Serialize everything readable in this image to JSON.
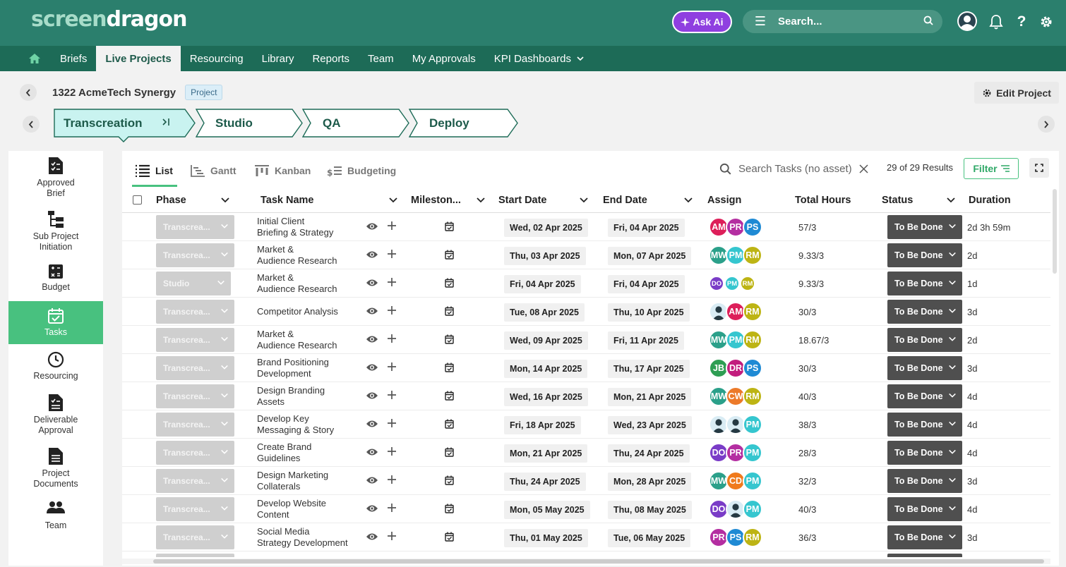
{
  "app": {
    "logo_part1": "screen",
    "logo_part2": "dragon"
  },
  "topbar": {
    "ask_ai_label": "Ask Ai",
    "search_placeholder": "Search...",
    "icons": [
      "user-avatar-icon",
      "bell-icon",
      "help-icon",
      "gear-icon"
    ]
  },
  "nav": {
    "items": [
      {
        "label": ""
      },
      {
        "label": "Briefs"
      },
      {
        "label": "Live Projects",
        "active": true
      },
      {
        "label": "Resourcing"
      },
      {
        "label": "Library"
      },
      {
        "label": "Reports"
      },
      {
        "label": "Team"
      },
      {
        "label": "My Approvals"
      },
      {
        "label": "KPI Dashboards"
      }
    ]
  },
  "project": {
    "title": "1322 AcmeTech Synergy",
    "badge": "Project",
    "edit_label": "Edit Project"
  },
  "phases": [
    {
      "label": "Transcreation",
      "active": true
    },
    {
      "label": "Studio"
    },
    {
      "label": "QA"
    },
    {
      "label": "Deploy"
    }
  ],
  "sidebar": {
    "items": [
      {
        "label1": "Approved",
        "label2": "Brief",
        "icon": "checklist-document-icon"
      },
      {
        "label1": "Sub Project",
        "label2": "Initiation",
        "icon": "hierarchy-icon"
      },
      {
        "label1": "Budget",
        "label2": "",
        "icon": "calculator-icon"
      },
      {
        "label1": "Tasks",
        "label2": "",
        "icon": "calendar-check-icon",
        "active": true
      },
      {
        "label1": "Resourcing",
        "label2": "",
        "icon": "clock-icon"
      },
      {
        "label1": "Deliverable",
        "label2": "Approval",
        "icon": "document-check-icon"
      },
      {
        "label1": "Project",
        "label2": "Documents",
        "icon": "document-icon"
      },
      {
        "label1": "Team",
        "label2": "",
        "icon": "people-icon"
      }
    ]
  },
  "views": [
    {
      "label": "List",
      "active": true
    },
    {
      "label": "Gantt"
    },
    {
      "label": "Kanban"
    },
    {
      "label": "Budgeting"
    }
  ],
  "task_search": {
    "placeholder": "Search Tasks (no asset)",
    "results": "29 of 29 Results",
    "filter_label": "Filter"
  },
  "columns": [
    "Phase",
    "Task Name",
    "Mileston...",
    "Start Date",
    "End Date",
    "Assign",
    "Total Hours",
    "Status",
    "Duration"
  ],
  "colors": {
    "brand": "#2b7f6d",
    "nav": "#1d6b57",
    "accent": "#48c17f",
    "ask_ai": "#8f3fe0",
    "status_bg": "#4f4f4f"
  },
  "avatar_colors": {
    "AM": "#dd1f5a",
    "PR": "#b42ea1",
    "PS": "#1f8ad4",
    "MW": "#2ba08a",
    "PM": "#35c6cf",
    "RM": "#bdb414",
    "DO": "#7a3cc7",
    "JB": "#2e9e53",
    "DR": "#c21d7d",
    "CW": "#ec7a2a",
    "CD": "#f07a1c"
  },
  "tasks": [
    {
      "phase": "Transcrea...",
      "name1": "Initial Client",
      "name2": "Briefing & Strategy",
      "start": "Wed, 02 Apr 2025",
      "end": "Fri, 04 Apr 2025",
      "assign": [
        "AM",
        "PR",
        "PS"
      ],
      "hours": "57/3",
      "status": "To Be Done",
      "duration": "2d 3h 59m"
    },
    {
      "phase": "Transcrea...",
      "name1": "Market &",
      "name2": "Audience Research",
      "start": "Thu, 03 Apr 2025",
      "end": "Mon, 07 Apr 2025",
      "assign": [
        "MW",
        "PM",
        "RM"
      ],
      "hours": "9.33/3",
      "status": "To Be Done",
      "duration": "2d"
    },
    {
      "phase": "Studio",
      "name1": "Market &",
      "name2": "Audience Research",
      "start": "Fri, 04 Apr 2025",
      "end": "Fri, 04 Apr 2025",
      "assign": [
        "DO",
        "PM",
        "RM"
      ],
      "assign_small": true,
      "hours": "9.33/3",
      "status": "To Be Done",
      "duration": "1d"
    },
    {
      "phase": "Transcrea...",
      "name1": "Competitor Analysis",
      "name2": "",
      "start": "Tue, 08 Apr 2025",
      "end": "Thu, 10 Apr 2025",
      "assign": [
        "@",
        "AM",
        "RM"
      ],
      "hours": "30/3",
      "status": "To Be Done",
      "duration": "3d"
    },
    {
      "phase": "Transcrea...",
      "name1": "Market &",
      "name2": "Audience Research",
      "start": "Wed, 09 Apr 2025",
      "end": "Fri, 11 Apr 2025",
      "assign": [
        "MW",
        "PM",
        "RM"
      ],
      "hours": "18.67/3",
      "status": "To Be Done",
      "duration": "2d"
    },
    {
      "phase": "Transcrea...",
      "name1": "Brand Positioning",
      "name2": "Development",
      "start": "Mon, 14 Apr 2025",
      "end": "Thu, 17 Apr 2025",
      "assign": [
        "JB",
        "DR",
        "PS"
      ],
      "hours": "30/3",
      "status": "To Be Done",
      "duration": "3d"
    },
    {
      "phase": "Transcrea...",
      "name1": "Design Branding",
      "name2": "Assets",
      "start": "Wed, 16 Apr 2025",
      "end": "Mon, 21 Apr 2025",
      "assign": [
        "MW",
        "CW",
        "RM"
      ],
      "hours": "40/3",
      "status": "To Be Done",
      "duration": "4d"
    },
    {
      "phase": "Transcrea...",
      "name1": "Develop Key",
      "name2": "Messaging & Story",
      "start": "Fri, 18 Apr 2025",
      "end": "Wed, 23 Apr 2025",
      "assign": [
        "@",
        "@",
        "PM"
      ],
      "hours": "38/3",
      "status": "To Be Done",
      "duration": "4d"
    },
    {
      "phase": "Transcrea...",
      "name1": "Create Brand",
      "name2": "Guidelines",
      "start": "Mon, 21 Apr 2025",
      "end": "Thu, 24 Apr 2025",
      "assign": [
        "DO",
        "PR",
        "PM"
      ],
      "hours": "28/3",
      "status": "To Be Done",
      "duration": "4d"
    },
    {
      "phase": "Transcrea...",
      "name1": "Design Marketing",
      "name2": "Collaterals",
      "start": "Thu, 24 Apr 2025",
      "end": "Mon, 28 Apr 2025",
      "assign": [
        "MW",
        "CD",
        "PM"
      ],
      "hours": "32/3",
      "status": "To Be Done",
      "duration": "3d"
    },
    {
      "phase": "Transcrea...",
      "name1": "Develop Website",
      "name2": "Content",
      "start": "Mon, 05 May 2025",
      "end": "Thu, 08 May 2025",
      "assign": [
        "DO",
        "@",
        "PM"
      ],
      "hours": "40/3",
      "status": "To Be Done",
      "duration": "4d"
    },
    {
      "phase": "Transcrea...",
      "name1": "Social Media",
      "name2": "Strategy Development",
      "start": "Thu, 01 May 2025",
      "end": "Tue, 06 May 2025",
      "assign": [
        "PR",
        "PS",
        "RM"
      ],
      "hours": "36/3",
      "status": "To Be Done",
      "duration": "3d"
    }
  ]
}
